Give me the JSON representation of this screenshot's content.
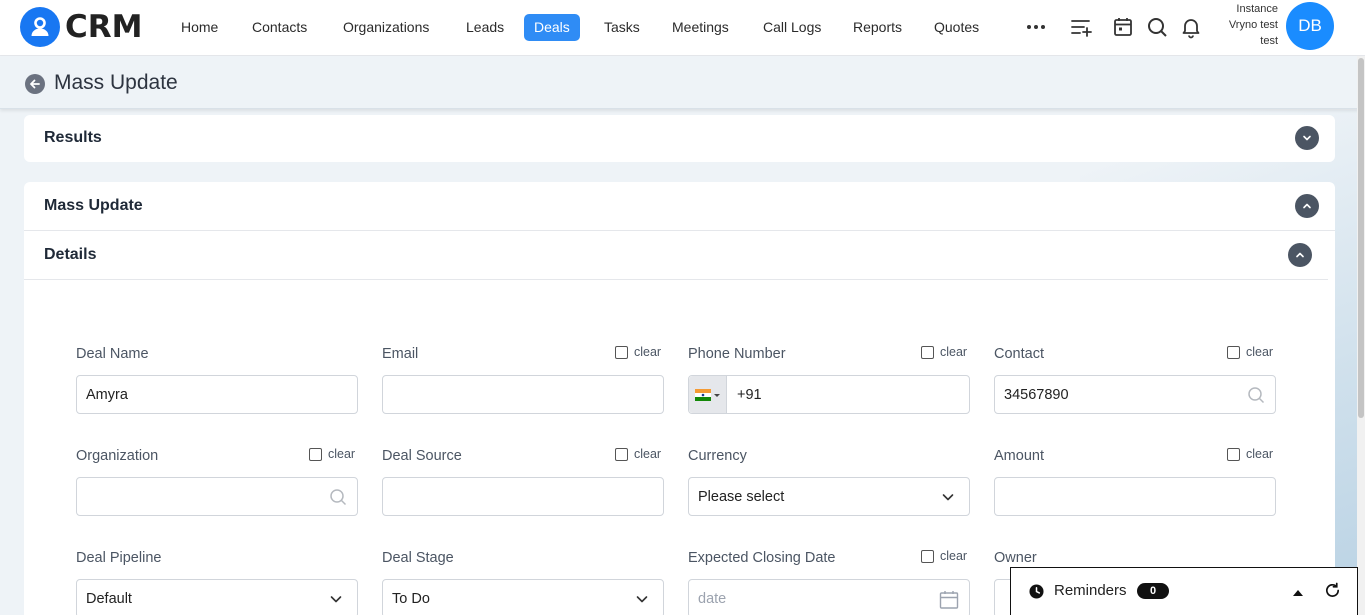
{
  "app": {
    "logo_text": "CRM",
    "instance_line1": "Instance",
    "instance_line2": "Vryno test",
    "instance_line3": "test",
    "avatar_initials": "DB",
    "accent_color": "#1a8cff"
  },
  "nav": {
    "items": [
      "Home",
      "Contacts",
      "Organizations",
      "Leads",
      "Deals",
      "Tasks",
      "Meetings",
      "Call Logs",
      "Reports",
      "Quotes"
    ],
    "active": "Deals",
    "more_icon": "more-horizontal-icon",
    "icons": [
      "add-list-icon",
      "calendar-icon",
      "search-icon",
      "bell-icon"
    ]
  },
  "page": {
    "title": "Mass Update",
    "back_icon": "arrow-left-icon"
  },
  "sections": {
    "results": "Results",
    "mass_update": "Mass Update",
    "details": "Details"
  },
  "fields": {
    "clear_label": "clear",
    "deal_name": {
      "label": "Deal Name",
      "value": "Amyra"
    },
    "email": {
      "label": "Email",
      "value": ""
    },
    "phone": {
      "label": "Phone Number",
      "value": "+91",
      "flag": "india-flag-icon"
    },
    "contact": {
      "label": "Contact",
      "value": "34567890"
    },
    "organization": {
      "label": "Organization",
      "value": ""
    },
    "deal_source": {
      "label": "Deal Source",
      "value": ""
    },
    "currency": {
      "label": "Currency",
      "value": "Please select"
    },
    "amount": {
      "label": "Amount",
      "value": ""
    },
    "deal_pipeline": {
      "label": "Deal Pipeline",
      "value": "Default"
    },
    "deal_stage": {
      "label": "Deal Stage",
      "value": "To Do"
    },
    "expected_closing_date": {
      "label": "Expected Closing Date",
      "placeholder": "date"
    },
    "owner": {
      "label": "Owner"
    }
  },
  "reminders": {
    "label": "Reminders",
    "count": "0"
  }
}
